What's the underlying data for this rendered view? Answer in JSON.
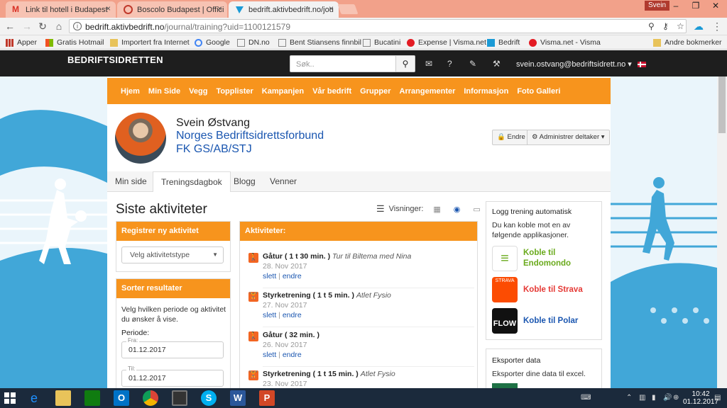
{
  "browser": {
    "tabs": [
      {
        "title": "Link til hotell i Budapest"
      },
      {
        "title": "Boscolo Budapest | Offici"
      },
      {
        "title": "bedrift.aktivbedrift.no/jou"
      }
    ],
    "profile": "Svein",
    "url_domain": "bedrift.aktivbedrift.no",
    "url_path": "/journal/training?uid=1100121579",
    "bookmarks": [
      "Apper",
      "Gratis Hotmail",
      "Importert fra Internet",
      "Google",
      "DN.no",
      "Bent Stiansens finnbil",
      "Bucatini",
      "Expense | Visma.net",
      "Bedrift",
      "Visma.net - Visma",
      "Andre bokmerker"
    ]
  },
  "site": {
    "logo": "BEDRIFTSIDRETTEN",
    "search_placeholder": "Søk..",
    "user_email": "svein.ostvang@bedriftsidrett.no",
    "nav": [
      "Hjem",
      "Min Side",
      "Vegg",
      "Topplister",
      "Kampanjen",
      "Vår bedrift",
      "Grupper",
      "Arrangementer",
      "Informasjon",
      "Foto Galleri"
    ]
  },
  "profile": {
    "name": "Svein Østvang",
    "organization": "Norges Bedriftsidrettsforbund",
    "club": "FK GS/AB/STJ",
    "edit_label": "Endre",
    "admin_label": "Administrer deltaker"
  },
  "subtabs": [
    "Min side",
    "Treningsdagbok",
    "Blogg",
    "Venner"
  ],
  "page_title": "Siste aktiviteter",
  "views_label": "Visninger:",
  "register": {
    "title": "Registrer ny aktivitet",
    "select_placeholder": "Velg aktivitetstype"
  },
  "sort": {
    "title": "Sorter resultater",
    "desc": "Velg hvilken periode og aktivitet du ønsker å vise.",
    "period_label": "Periode:",
    "from_label": "Fra:",
    "from_value": "01.12.2017",
    "to_label": "Til:",
    "to_value": "01.12.2017"
  },
  "activities": {
    "title": "Aktiviteter:",
    "delete_label": "slett",
    "edit_label": "endre",
    "items": [
      {
        "type": "Gåtur",
        "duration": "( 1 t 30 min. )",
        "note": "Tur til Biltema med Nina",
        "date": "28. Nov 2017",
        "icon": "walk-icon"
      },
      {
        "type": "Styrketrening",
        "duration": "( 1 t 5 min. )",
        "note": "Atlet Fysio",
        "date": "27. Nov 2017",
        "icon": "strength-icon"
      },
      {
        "type": "Gåtur",
        "duration": "( 32 min. )",
        "note": "",
        "date": "26. Nov 2017",
        "icon": "walk-icon"
      },
      {
        "type": "Styrketrening",
        "duration": "( 1 t 15 min. )",
        "note": "Atlet Fysio",
        "date": "23. Nov 2017",
        "icon": "strength-icon"
      }
    ]
  },
  "auto_log": {
    "title": "Logg trening automatisk",
    "desc": "Du kan koble mot en av følgende applikasjoner.",
    "apps": [
      {
        "label": "Koble til Endomondo",
        "color": "#6aaa1c"
      },
      {
        "label": "Koble til Strava",
        "color": "#fc4c02"
      },
      {
        "label": "Koble til Polar",
        "color": "#1a56b0"
      }
    ]
  },
  "export": {
    "title": "Eksporter data",
    "desc": "Eksporter dine data til excel."
  },
  "taskbar": {
    "time": "10:42",
    "date": "01.12.2017"
  }
}
